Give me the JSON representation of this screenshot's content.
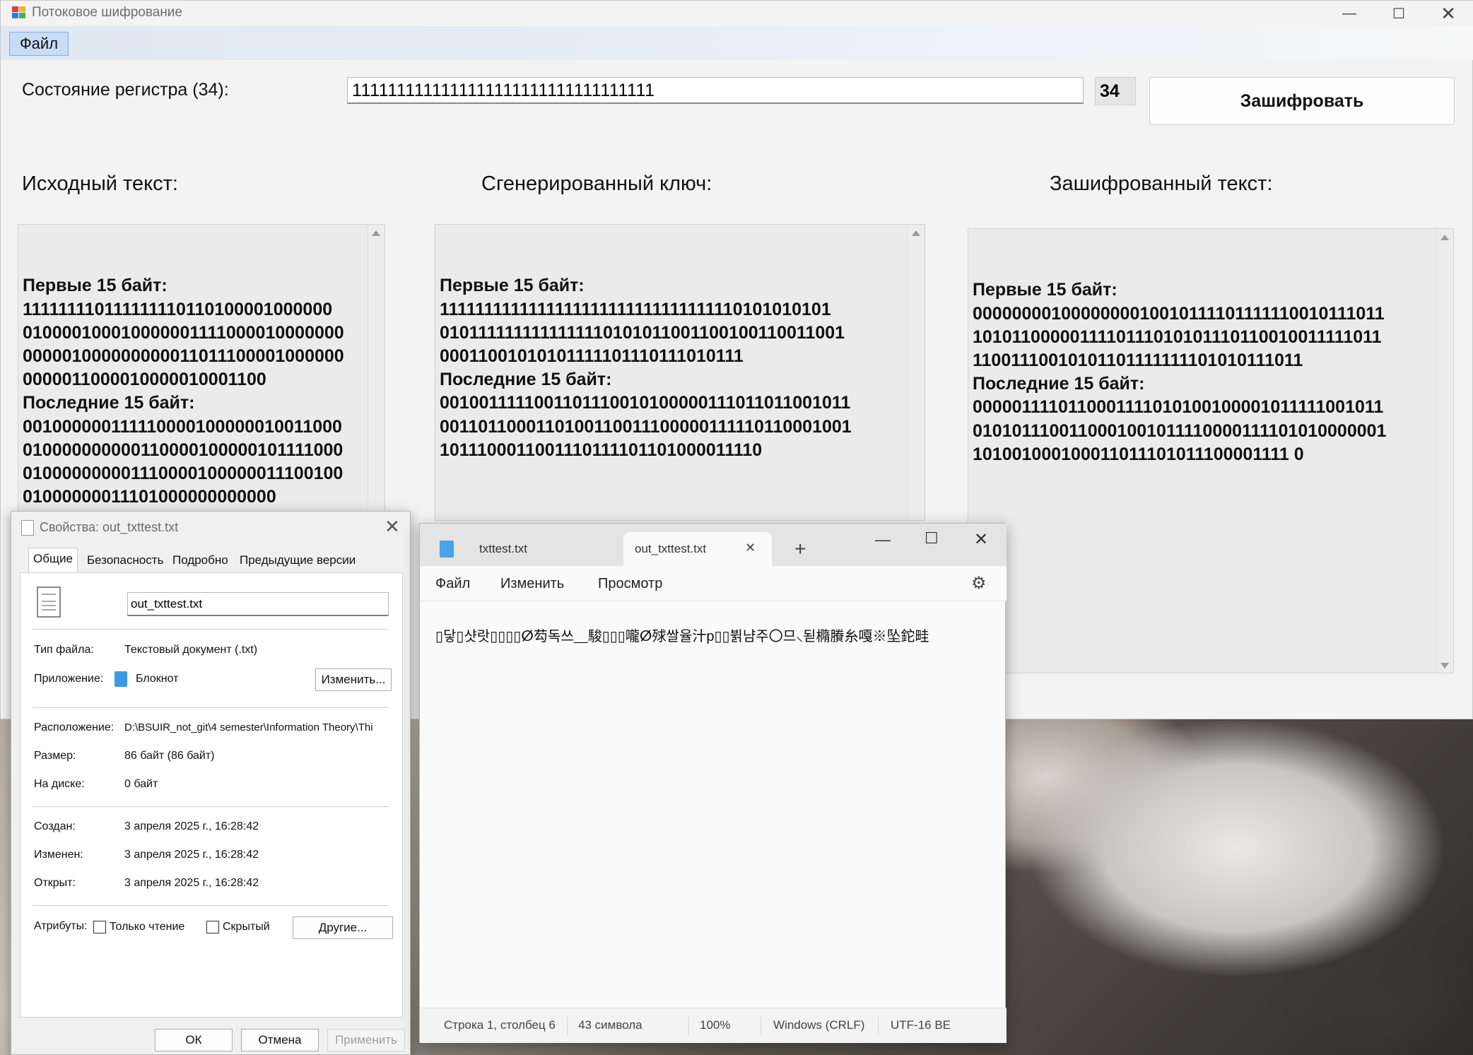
{
  "main_window": {
    "title": "Потоковое шифрование",
    "menu_file": "Файл",
    "register_label": "Состояние регистра (34):",
    "register_value": "1111111111111111111111111111111111",
    "register_length": "34",
    "encrypt_button": "Зашифровать",
    "source_heading": "Исходный текст:",
    "key_heading": "Сгенерированный ключ:",
    "cipher_heading": "Зашифрованный текст:",
    "source_text": "Первые 15 байт:\n111111110111111110110100001000000\n010000100010000001111000010000000\n000001000000000011011100001000000\n0000011000010000010001100\nПоследние 15 байт:\n001000000111110000100000010011000\n010000000000110000100000101111000\n010000000001110000100000011100100\n01000000011101000000000000",
    "key_text": "Первые 15 байт:\n1111111111111111111111111111111110101010101\n0101111111111111110101011001100100110011001\n00011001010101111101110111010111\nПоследние 15 байт:\n0010011111001101110010100000111011011001011\n0011011000110100110011100000111110110001001\n1011100011001110111101101000011110",
    "cipher_text": "Первые 15 байт:\n0000000010000000010010111101111110010111011\n1010110000011110111010101110110010011111011\n11001110010101101111111101010111011\nПоследние 15 байт:\n0000011110110001111010100100001011111001011\n0101011100110001001011110000111101010000001\n101001000100011011101011100001111 0"
  },
  "properties_dialog": {
    "title": "Свойства: out_txttest.txt",
    "tabs": [
      "Общие",
      "Безопасность",
      "Подробно",
      "Предыдущие версии"
    ],
    "file_name": "out_txttest.txt",
    "type_label": "Тип файла:",
    "type_value": "Текстовый документ (.txt)",
    "app_label": "Приложение:",
    "app_value": "Блокнот",
    "change_button": "Изменить...",
    "location_label": "Расположение:",
    "location_value": "D:\\BSUIR_not_git\\4 semester\\Information Theory\\Thi",
    "size_label": "Размер:",
    "size_value": "86 байт (86 байт)",
    "disk_label": "На диске:",
    "disk_value": "0 байт",
    "created_label": "Создан:",
    "created_value": "3 апреля 2025 г., 16:28:42",
    "modified_label": "Изменен:",
    "modified_value": "3 апреля 2025 г., 16:28:42",
    "opened_label": "Открыт:",
    "opened_value": "3 апреля 2025 г., 16:28:42",
    "attributes_label": "Атрибуты:",
    "readonly_label": "Только чтение",
    "hidden_label": "Скрытый",
    "other_button": "Другие...",
    "ok_button": "ОК",
    "cancel_button": "Отмена",
    "apply_button": "Применить"
  },
  "notepad": {
    "tab1": "txttest.txt",
    "tab2": "out_txttest.txt",
    "menu": [
      "Файл",
      "Изменить",
      "Просмотр"
    ],
    "content": "▯닿▯샷랏▯▯▯▯ⵁ芶독쓰⸏駿▯▯▯嚨ⵁ殏쌀율汁p▯▯뷝냠주〇므⸜됟橢賸糸嘎※坠鉈畦",
    "status_pos": "Строка 1, столбец 6",
    "status_chars": "43 символа",
    "status_zoom": "100%",
    "status_eol": "Windows (CRLF)",
    "status_enc": "UTF-16 BE"
  }
}
